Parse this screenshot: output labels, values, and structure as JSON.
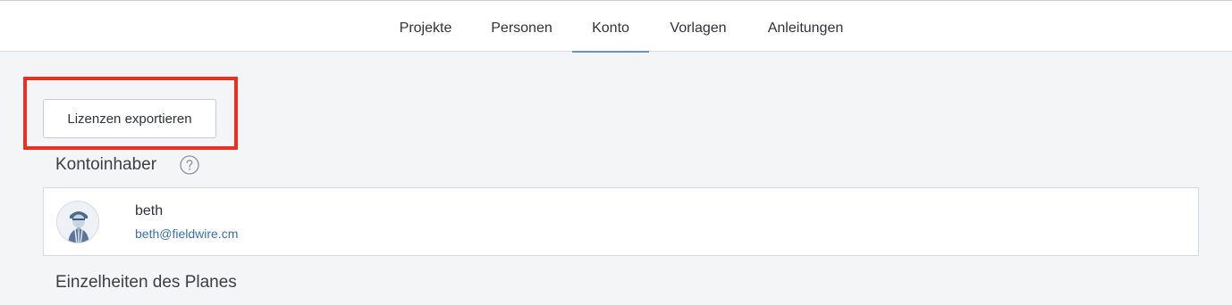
{
  "nav": {
    "tabs": [
      {
        "label": "Projekte"
      },
      {
        "label": "Personen"
      },
      {
        "label": "Konto",
        "active": true
      },
      {
        "label": "Vorlagen"
      },
      {
        "label": "Anleitungen"
      }
    ]
  },
  "toolbar": {
    "export_label": "Lizenzen exportieren"
  },
  "owner_section": {
    "title": "Kontoinhaber",
    "help_icon": "question-circle-icon",
    "owner": {
      "name": "beth",
      "email": "beth@fieldwire.cm"
    }
  },
  "plan_section": {
    "title": "Einzelheiten des Planes"
  },
  "colors": {
    "accent": "#6b93c8",
    "highlight": "#e8321f",
    "link": "#3a6fb8",
    "background": "#f4f5f7"
  }
}
